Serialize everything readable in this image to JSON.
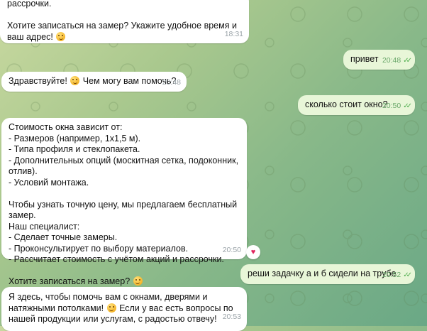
{
  "messages": [
    {
      "text": "рассрочки.\n\nХотите записаться на замер? Укажите удобное время и ваш адрес! ",
      "emoji": true,
      "time": "18:31"
    },
    {
      "text": "привет",
      "time": "20:48"
    },
    {
      "text": "Здравствуйте! ",
      "text2": " Чем могу вам помочь?",
      "emoji": true,
      "time": "20:48"
    },
    {
      "text": "сколько стоит окно?",
      "time": "20:50"
    },
    {
      "text": "Стоимость окна зависит от:\n- Размеров (например, 1х1,5 м).\n- Типа профиля и стеклопакета.\n- Дополнительных опций (москитная сетка, подоконник, отлив).\n- Условий монтажа.\n\nЧтобы узнать точную цену, мы предлагаем бесплатный замер.\nНаш специалист:\n- Сделает точные замеры.\n- Проконсультирует по выбору материалов.\n- Рассчитает стоимость с учётом акций и рассрочки.\n\nХотите записаться на замер? ",
      "emoji": true,
      "time": "20:50",
      "reaction": "♥"
    },
    {
      "text": "реши задачку а и б сидели на трубе",
      "time": "20:52"
    },
    {
      "text": "Я здесь, чтобы помочь вам с окнами, дверями и натяжными потолками! ",
      "text2": " Если у вас есть вопросы по нашей продукции или услугам, с радостью отвечу!",
      "emoji": true,
      "time": "20:53"
    }
  ],
  "read_check": "✓✓"
}
